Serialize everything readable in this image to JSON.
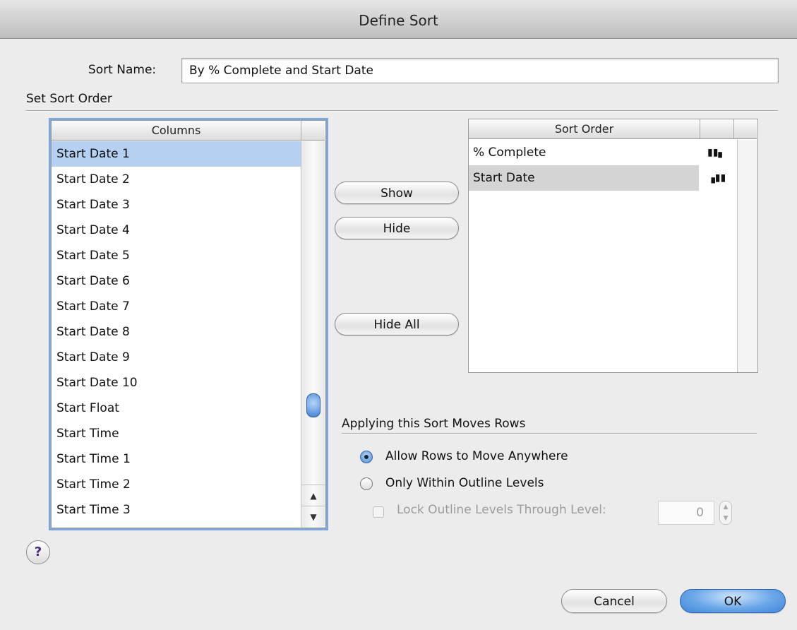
{
  "window": {
    "title": "Define Sort"
  },
  "sort_name": {
    "label": "Sort Name:",
    "value": "By % Complete and Start Date"
  },
  "set_sort_order_label": "Set Sort Order",
  "columns": {
    "header": "Columns",
    "items": [
      "Start Date 1",
      "Start Date 2",
      "Start Date 3",
      "Start Date 4",
      "Start Date 5",
      "Start Date 6",
      "Start Date 7",
      "Start Date 8",
      "Start Date 9",
      "Start Date 10",
      "Start Float",
      "Start Time",
      "Start Time 1",
      "Start Time 2",
      "Start Time 3"
    ],
    "selected": "Start Date 1"
  },
  "buttons": {
    "show": "Show",
    "hide": "Hide",
    "hide_all": "Hide All",
    "cancel": "Cancel",
    "ok": "OK",
    "help": "?"
  },
  "sort_order": {
    "header": "Sort Order",
    "items": [
      {
        "label": "% Complete",
        "direction_icon": "descending-bars-icon",
        "glyph": "▮▮▖"
      },
      {
        "label": "Start Date",
        "direction_icon": "ascending-bars-icon",
        "glyph": "▗▮▮"
      }
    ],
    "selected": "Start Date"
  },
  "apply_section": {
    "label": "Applying this Sort Moves Rows",
    "radio_anywhere": "Allow Rows to Move Anywhere",
    "radio_within": "Only Within Outline Levels",
    "lock_label": "Lock Outline Levels Through Level:",
    "lock_level_value": "0",
    "selected_option": "anywhere"
  },
  "colors": {
    "accent": "#3f7ed4",
    "selection": "#b5d0f0"
  }
}
